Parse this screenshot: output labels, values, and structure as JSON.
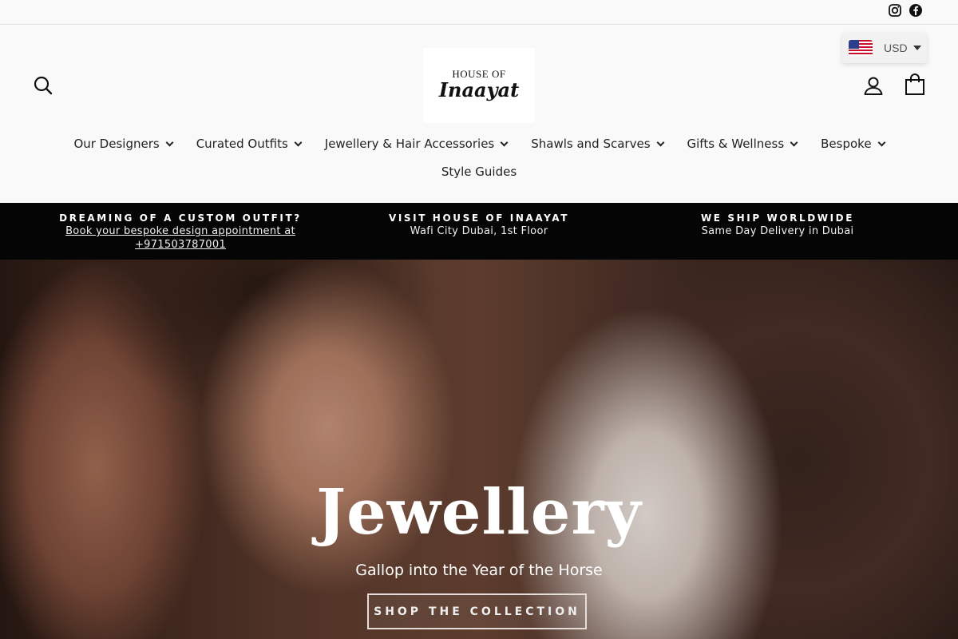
{
  "utility": {
    "social_icons": [
      "instagram-icon",
      "facebook-icon"
    ]
  },
  "header": {
    "logo": {
      "top_text": "HOUSE OF",
      "main_text": "Inaayat"
    },
    "currency": {
      "label": "USD",
      "flag": "us-flag-icon"
    },
    "icons": [
      "search-icon",
      "account-icon",
      "cart-icon"
    ]
  },
  "nav": {
    "items": [
      {
        "label": "Our Designers",
        "has_dropdown": true
      },
      {
        "label": "Curated Outfits",
        "has_dropdown": true
      },
      {
        "label": "Jewellery & Hair Accessories",
        "has_dropdown": true
      },
      {
        "label": "Shawls and Scarves",
        "has_dropdown": true
      },
      {
        "label": "Gifts & Wellness",
        "has_dropdown": true
      },
      {
        "label": "Bespoke",
        "has_dropdown": true
      },
      {
        "label": "Style Guides",
        "has_dropdown": false
      }
    ]
  },
  "announcements": [
    {
      "title": "DREAMING OF A CUSTOM OUTFIT?",
      "line1": "Book your bespoke design appointment at",
      "line2": "+971503787001"
    },
    {
      "title": "VISIT HOUSE OF INAAYAT",
      "line1": "Wafi City Dubai, 1st Floor"
    },
    {
      "title": "WE SHIP WORLDWIDE",
      "line1": "Same Day Delivery in Dubai"
    }
  ],
  "hero": {
    "title": "Jewellery",
    "subtitle": "Gallop into the Year of the Horse",
    "button_label": "SHOP THE COLLECTION"
  },
  "colors": {
    "announcement_bg": "#050505",
    "page_bg": "#f9f9f9",
    "text": "#1a1a1a"
  }
}
